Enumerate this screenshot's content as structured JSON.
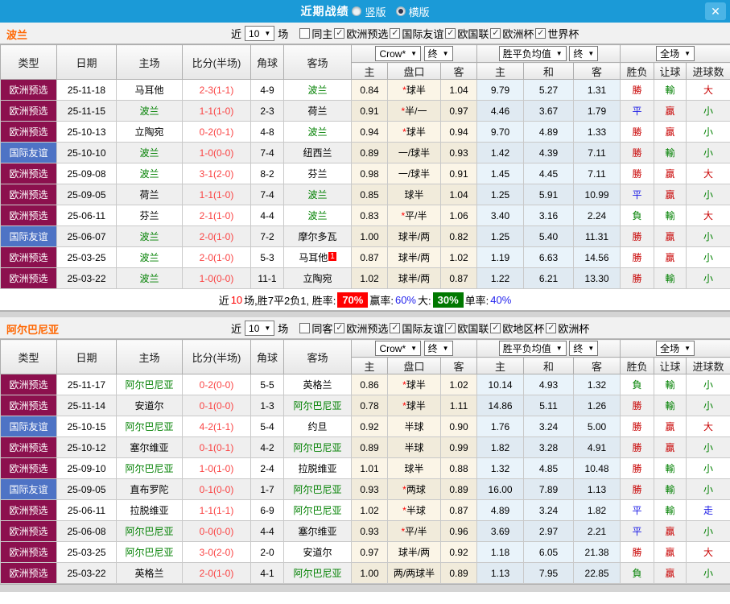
{
  "topbar": {
    "title": "近期战绩",
    "options": [
      {
        "label": "竖版",
        "checked": false
      },
      {
        "label": "横版",
        "checked": true
      }
    ]
  },
  "icons": {
    "close_glyph": "✕",
    "dropdown_arrow": "▼",
    "check_glyph": "✓"
  },
  "colors": {
    "topbar_bg": "#1B9AD7",
    "qualifier_type_bg": "#8C104E",
    "friendly_type_bg": "#4E73C5",
    "focus_team_green": "#008000",
    "score_red": "#FA4343",
    "win_red": "#C80000",
    "lose_green": "#008000",
    "draw_blue": "#1A1AE6",
    "team_name_orange": "#FF6600",
    "rate_badge_red": "#FF0000",
    "rate_badge_green": "#007800",
    "rate_text_blue": "#2323EE"
  },
  "sections": [
    {
      "team": "波兰",
      "filters": {
        "near_label": "近",
        "games": "10",
        "games_unit": "场",
        "same_label": "同主",
        "same_checked": false,
        "leagues": [
          "欧洲预选",
          "国际友谊",
          "欧国联",
          "欧洲杯",
          "世界杯"
        ]
      },
      "selects": {
        "odds_source": "Crow*",
        "final_a": "终",
        "avg_label": "胜平负均值",
        "final_b": "终",
        "scope": "全场"
      },
      "columns": [
        "类型",
        "日期",
        "主场",
        "比分(半场)",
        "角球",
        "客场"
      ],
      "subcolumns": [
        "主",
        "盘口",
        "客",
        "主",
        "和",
        "客",
        "胜负",
        "让球",
        "进球数"
      ],
      "rows": [
        {
          "competition": "欧洲预选",
          "style": "qual",
          "date": "25-11-18",
          "home": "马耳他",
          "home_is_focus": false,
          "score": "2-3",
          "half_score": "(1-1)",
          "corners": "4-9",
          "away": "波兰",
          "away_is_focus": true,
          "away_badge": "",
          "odds_home": "0.84",
          "handicap": "*球半",
          "odds_away": "1.04",
          "avg_win": "9.79",
          "avg_draw": "5.27",
          "avg_lose": "1.31",
          "result": "勝",
          "result_color": "red",
          "handicap_result": "輸",
          "handicap_result_color": "green",
          "goals_result": "大",
          "goals_result_color": "red"
        },
        {
          "competition": "欧洲预选",
          "style": "qual",
          "date": "25-11-15",
          "home": "波兰",
          "home_is_focus": true,
          "score": "1-1",
          "half_score": "(1-0)",
          "corners": "2-3",
          "away": "荷兰",
          "away_is_focus": false,
          "away_badge": "",
          "odds_home": "0.91",
          "handicap": "*半/一",
          "odds_away": "0.97",
          "avg_win": "4.46",
          "avg_draw": "3.67",
          "avg_lose": "1.79",
          "result": "平",
          "result_color": "blue",
          "handicap_result": "贏",
          "handicap_result_color": "red",
          "goals_result": "小",
          "goals_result_color": "green"
        },
        {
          "competition": "欧洲预选",
          "style": "qual",
          "date": "25-10-13",
          "home": "立陶宛",
          "home_is_focus": false,
          "score": "0-2",
          "half_score": "(0-1)",
          "corners": "4-8",
          "away": "波兰",
          "away_is_focus": true,
          "away_badge": "",
          "odds_home": "0.94",
          "handicap": "*球半",
          "odds_away": "0.94",
          "avg_win": "9.70",
          "avg_draw": "4.89",
          "avg_lose": "1.33",
          "result": "勝",
          "result_color": "red",
          "handicap_result": "贏",
          "handicap_result_color": "red",
          "goals_result": "小",
          "goals_result_color": "green"
        },
        {
          "competition": "国际友谊",
          "style": "frnd",
          "date": "25-10-10",
          "home": "波兰",
          "home_is_focus": true,
          "score": "1-0",
          "half_score": "(0-0)",
          "corners": "7-4",
          "away": "纽西兰",
          "away_is_focus": false,
          "away_badge": "",
          "odds_home": "0.89",
          "handicap": "一/球半",
          "odds_away": "0.93",
          "avg_win": "1.42",
          "avg_draw": "4.39",
          "avg_lose": "7.11",
          "result": "勝",
          "result_color": "red",
          "handicap_result": "輸",
          "handicap_result_color": "green",
          "goals_result": "小",
          "goals_result_color": "green"
        },
        {
          "competition": "欧洲预选",
          "style": "qual",
          "date": "25-09-08",
          "home": "波兰",
          "home_is_focus": true,
          "score": "3-1",
          "half_score": "(2-0)",
          "corners": "8-2",
          "away": "芬兰",
          "away_is_focus": false,
          "away_badge": "",
          "odds_home": "0.98",
          "handicap": "一/球半",
          "odds_away": "0.91",
          "avg_win": "1.45",
          "avg_draw": "4.45",
          "avg_lose": "7.11",
          "result": "勝",
          "result_color": "red",
          "handicap_result": "贏",
          "handicap_result_color": "red",
          "goals_result": "大",
          "goals_result_color": "red"
        },
        {
          "competition": "欧洲预选",
          "style": "qual",
          "date": "25-09-05",
          "home": "荷兰",
          "home_is_focus": false,
          "score": "1-1",
          "half_score": "(1-0)",
          "corners": "7-4",
          "away": "波兰",
          "away_is_focus": true,
          "away_badge": "",
          "odds_home": "0.85",
          "handicap": "球半",
          "odds_away": "1.04",
          "avg_win": "1.25",
          "avg_draw": "5.91",
          "avg_lose": "10.99",
          "result": "平",
          "result_color": "blue",
          "handicap_result": "贏",
          "handicap_result_color": "red",
          "goals_result": "小",
          "goals_result_color": "green"
        },
        {
          "competition": "欧洲预选",
          "style": "qual",
          "date": "25-06-11",
          "home": "芬兰",
          "home_is_focus": false,
          "score": "2-1",
          "half_score": "(1-0)",
          "corners": "4-4",
          "away": "波兰",
          "away_is_focus": true,
          "away_badge": "",
          "odds_home": "0.83",
          "handicap": "*平/半",
          "odds_away": "1.06",
          "avg_win": "3.40",
          "avg_draw": "3.16",
          "avg_lose": "2.24",
          "result": "負",
          "result_color": "green",
          "handicap_result": "輸",
          "handicap_result_color": "green",
          "goals_result": "大",
          "goals_result_color": "red"
        },
        {
          "competition": "国际友谊",
          "style": "frnd",
          "date": "25-06-07",
          "home": "波兰",
          "home_is_focus": true,
          "score": "2-0",
          "half_score": "(1-0)",
          "corners": "7-2",
          "away": "摩尔多瓦",
          "away_is_focus": false,
          "away_badge": "",
          "odds_home": "1.00",
          "handicap": "球半/两",
          "odds_away": "0.82",
          "avg_win": "1.25",
          "avg_draw": "5.40",
          "avg_lose": "11.31",
          "result": "勝",
          "result_color": "red",
          "handicap_result": "贏",
          "handicap_result_color": "red",
          "goals_result": "小",
          "goals_result_color": "green"
        },
        {
          "competition": "欧洲预选",
          "style": "qual",
          "date": "25-03-25",
          "home": "波兰",
          "home_is_focus": true,
          "score": "2-0",
          "half_score": "(1-0)",
          "corners": "5-3",
          "away": "马耳他",
          "away_is_focus": false,
          "away_badge": "1",
          "odds_home": "0.87",
          "handicap": "球半/两",
          "odds_away": "1.02",
          "avg_win": "1.19",
          "avg_draw": "6.63",
          "avg_lose": "14.56",
          "result": "勝",
          "result_color": "red",
          "handicap_result": "贏",
          "handicap_result_color": "red",
          "goals_result": "小",
          "goals_result_color": "green"
        },
        {
          "competition": "欧洲预选",
          "style": "qual",
          "date": "25-03-22",
          "home": "波兰",
          "home_is_focus": true,
          "score": "1-0",
          "half_score": "(0-0)",
          "corners": "11-1",
          "away": "立陶宛",
          "away_is_focus": false,
          "away_badge": "",
          "odds_home": "1.02",
          "handicap": "球半/两",
          "odds_away": "0.87",
          "avg_win": "1.22",
          "avg_draw": "6.21",
          "avg_lose": "13.30",
          "result": "勝",
          "result_color": "red",
          "handicap_result": "輸",
          "handicap_result_color": "green",
          "goals_result": "小",
          "goals_result_color": "green"
        }
      ],
      "summary": {
        "prefix": "近",
        "count": "10",
        "stats": "场,胜7平2负1, 胜率:",
        "win_rate": "70%",
        "label_win_odds": "赢率:",
        "win_odds_rate": "60%",
        "label_big": "大:",
        "big_rate": "30%",
        "label_single": "单率:",
        "single_rate": "40%"
      }
    },
    {
      "team": "阿尔巴尼亚",
      "filters": {
        "near_label": "近",
        "games": "10",
        "games_unit": "场",
        "same_label": "同客",
        "same_checked": false,
        "leagues": [
          "欧洲预选",
          "国际友谊",
          "欧国联",
          "欧地区杯",
          "欧洲杯"
        ]
      },
      "selects": {
        "odds_source": "Crow*",
        "final_a": "终",
        "avg_label": "胜平负均值",
        "final_b": "终",
        "scope": "全场"
      },
      "columns": [
        "类型",
        "日期",
        "主场",
        "比分(半场)",
        "角球",
        "客场"
      ],
      "subcolumns": [
        "主",
        "盘口",
        "客",
        "主",
        "和",
        "客",
        "胜负",
        "让球",
        "进球数"
      ],
      "rows": [
        {
          "competition": "欧洲预选",
          "style": "qual",
          "date": "25-11-17",
          "home": "阿尔巴尼亚",
          "home_is_focus": true,
          "score": "0-2",
          "half_score": "(0-0)",
          "corners": "5-5",
          "away": "英格兰",
          "away_is_focus": false,
          "away_badge": "",
          "odds_home": "0.86",
          "handicap": "*球半",
          "odds_away": "1.02",
          "avg_win": "10.14",
          "avg_draw": "4.93",
          "avg_lose": "1.32",
          "result": "負",
          "result_color": "green",
          "handicap_result": "輸",
          "handicap_result_color": "green",
          "goals_result": "小",
          "goals_result_color": "green"
        },
        {
          "competition": "欧洲预选",
          "style": "qual",
          "date": "25-11-14",
          "home": "安道尔",
          "home_is_focus": false,
          "score": "0-1",
          "half_score": "(0-0)",
          "corners": "1-3",
          "away": "阿尔巴尼亚",
          "away_is_focus": true,
          "away_badge": "",
          "odds_home": "0.78",
          "handicap": "*球半",
          "odds_away": "1.11",
          "avg_win": "14.86",
          "avg_draw": "5.11",
          "avg_lose": "1.26",
          "result": "勝",
          "result_color": "red",
          "handicap_result": "輸",
          "handicap_result_color": "green",
          "goals_result": "小",
          "goals_result_color": "green"
        },
        {
          "competition": "国际友谊",
          "style": "frnd",
          "date": "25-10-15",
          "home": "阿尔巴尼亚",
          "home_is_focus": true,
          "score": "4-2",
          "half_score": "(1-1)",
          "corners": "5-4",
          "away": "约旦",
          "away_is_focus": false,
          "away_badge": "",
          "odds_home": "0.92",
          "handicap": "半球",
          "odds_away": "0.90",
          "avg_win": "1.76",
          "avg_draw": "3.24",
          "avg_lose": "5.00",
          "result": "勝",
          "result_color": "red",
          "handicap_result": "贏",
          "handicap_result_color": "red",
          "goals_result": "大",
          "goals_result_color": "red"
        },
        {
          "competition": "欧洲预选",
          "style": "qual",
          "date": "25-10-12",
          "home": "塞尔维亚",
          "home_is_focus": false,
          "score": "0-1",
          "half_score": "(0-1)",
          "corners": "4-2",
          "away": "阿尔巴尼亚",
          "away_is_focus": true,
          "away_badge": "",
          "odds_home": "0.89",
          "handicap": "半球",
          "odds_away": "0.99",
          "avg_win": "1.82",
          "avg_draw": "3.28",
          "avg_lose": "4.91",
          "result": "勝",
          "result_color": "red",
          "handicap_result": "贏",
          "handicap_result_color": "red",
          "goals_result": "小",
          "goals_result_color": "green"
        },
        {
          "competition": "欧洲预选",
          "style": "qual",
          "date": "25-09-10",
          "home": "阿尔巴尼亚",
          "home_is_focus": true,
          "score": "1-0",
          "half_score": "(1-0)",
          "corners": "2-4",
          "away": "拉脱维亚",
          "away_is_focus": false,
          "away_badge": "",
          "odds_home": "1.01",
          "handicap": "球半",
          "odds_away": "0.88",
          "avg_win": "1.32",
          "avg_draw": "4.85",
          "avg_lose": "10.48",
          "result": "勝",
          "result_color": "red",
          "handicap_result": "輸",
          "handicap_result_color": "green",
          "goals_result": "小",
          "goals_result_color": "green"
        },
        {
          "competition": "国际友谊",
          "style": "frnd",
          "date": "25-09-05",
          "home": "直布罗陀",
          "home_is_focus": false,
          "score": "0-1",
          "half_score": "(0-0)",
          "corners": "1-7",
          "away": "阿尔巴尼亚",
          "away_is_focus": true,
          "away_badge": "",
          "odds_home": "0.93",
          "handicap": "*两球",
          "odds_away": "0.89",
          "avg_win": "16.00",
          "avg_draw": "7.89",
          "avg_lose": "1.13",
          "result": "勝",
          "result_color": "red",
          "handicap_result": "輸",
          "handicap_result_color": "green",
          "goals_result": "小",
          "goals_result_color": "green"
        },
        {
          "competition": "欧洲预选",
          "style": "qual",
          "date": "25-06-11",
          "home": "拉脱维亚",
          "home_is_focus": false,
          "score": "1-1",
          "half_score": "(1-1)",
          "corners": "6-9",
          "away": "阿尔巴尼亚",
          "away_is_focus": true,
          "away_badge": "",
          "odds_home": "1.02",
          "handicap": "*半球",
          "odds_away": "0.87",
          "avg_win": "4.89",
          "avg_draw": "3.24",
          "avg_lose": "1.82",
          "result": "平",
          "result_color": "blue",
          "handicap_result": "輸",
          "handicap_result_color": "green",
          "goals_result": "走",
          "goals_result_color": "blue"
        },
        {
          "competition": "欧洲预选",
          "style": "qual",
          "date": "25-06-08",
          "home": "阿尔巴尼亚",
          "home_is_focus": true,
          "score": "0-0",
          "half_score": "(0-0)",
          "corners": "4-4",
          "away": "塞尔维亚",
          "away_is_focus": false,
          "away_badge": "",
          "odds_home": "0.93",
          "handicap": "*平/半",
          "odds_away": "0.96",
          "avg_win": "3.69",
          "avg_draw": "2.97",
          "avg_lose": "2.21",
          "result": "平",
          "result_color": "blue",
          "handicap_result": "贏",
          "handicap_result_color": "red",
          "goals_result": "小",
          "goals_result_color": "green"
        },
        {
          "competition": "欧洲预选",
          "style": "qual",
          "date": "25-03-25",
          "home": "阿尔巴尼亚",
          "home_is_focus": true,
          "score": "3-0",
          "half_score": "(2-0)",
          "corners": "2-0",
          "away": "安道尔",
          "away_is_focus": false,
          "away_badge": "",
          "odds_home": "0.97",
          "handicap": "球半/两",
          "odds_away": "0.92",
          "avg_win": "1.18",
          "avg_draw": "6.05",
          "avg_lose": "21.38",
          "result": "勝",
          "result_color": "red",
          "handicap_result": "贏",
          "handicap_result_color": "red",
          "goals_result": "大",
          "goals_result_color": "red"
        },
        {
          "competition": "欧洲预选",
          "style": "qual",
          "date": "25-03-22",
          "home": "英格兰",
          "home_is_focus": false,
          "score": "2-0",
          "half_score": "(1-0)",
          "corners": "4-1",
          "away": "阿尔巴尼亚",
          "away_is_focus": true,
          "away_badge": "",
          "odds_home": "1.00",
          "handicap": "两/两球半",
          "odds_away": "0.89",
          "avg_win": "1.13",
          "avg_draw": "7.95",
          "avg_lose": "22.85",
          "result": "負",
          "result_color": "green",
          "handicap_result": "贏",
          "handicap_result_color": "red",
          "goals_result": "小",
          "goals_result_color": "green"
        }
      ]
    }
  ]
}
